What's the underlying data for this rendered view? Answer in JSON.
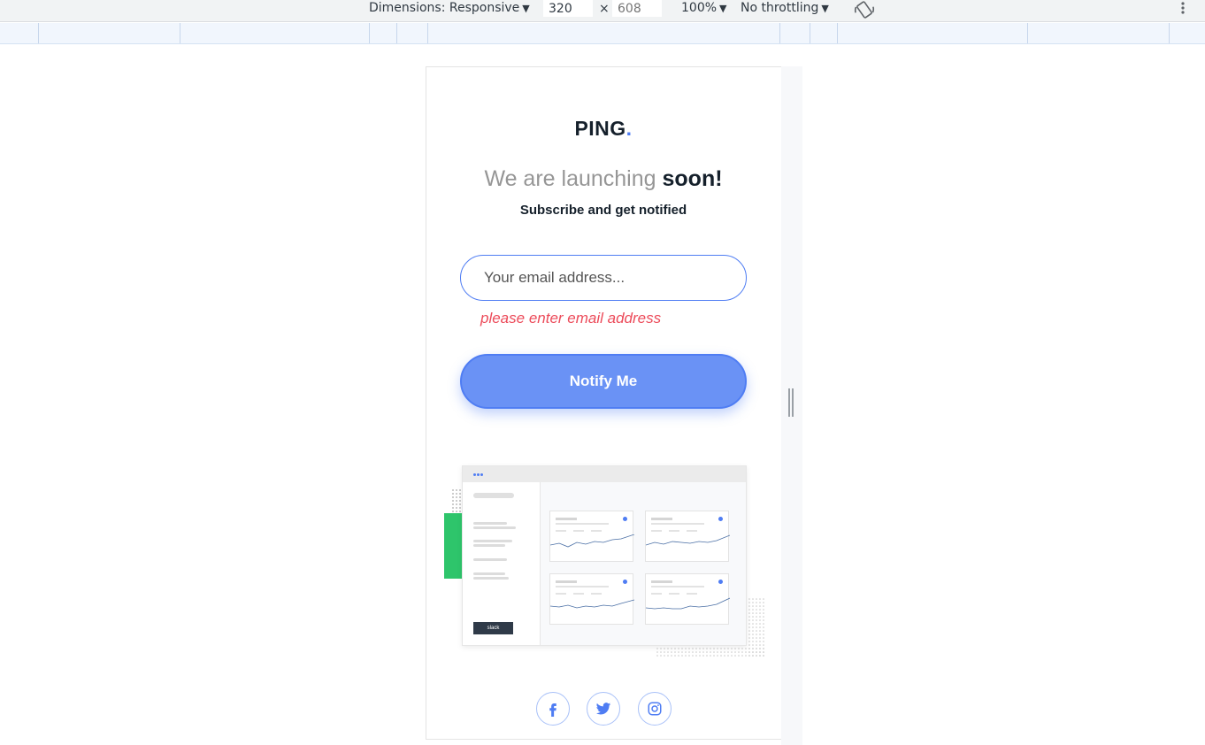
{
  "devtools": {
    "dimensions_label": "Dimensions: Responsive",
    "width_value": "320",
    "times": "×",
    "height_placeholder": "608",
    "zoom": "100%",
    "throttling": "No throttling",
    "rotate_icon": "rotate-icon",
    "more_icon": "more-vertical-icon"
  },
  "page": {
    "logo": "PING",
    "logo_dot": ".",
    "headline_light": "We are launching ",
    "headline_bold": "soon!",
    "subline": "Subscribe and get notified",
    "email_placeholder": "Your email address...",
    "error": "please enter email address",
    "notify_button": "Notify Me",
    "dashboard_badge": "slack",
    "social": [
      "facebook-icon",
      "twitter-icon",
      "instagram-icon"
    ]
  },
  "colors": {
    "brand_blue": "#4f7df3",
    "button_fill": "#6a92f5",
    "error_red": "#ec4b5a",
    "dark_text": "#15202b",
    "accent_green": "#2ec56b"
  }
}
